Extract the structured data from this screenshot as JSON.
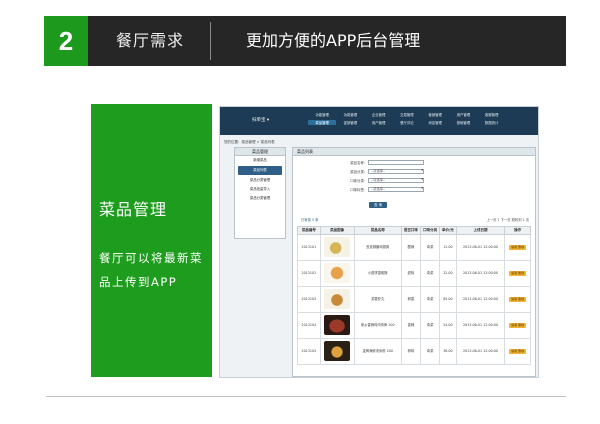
{
  "header": {
    "number": "2",
    "section": "餐厅需求",
    "title": "更加方便的APP后台管理"
  },
  "card": {
    "title": "菜品管理",
    "desc": "餐厅可以将最新菜品上传到APP"
  },
  "colors": {
    "header_bg": "#262626",
    "accent_green": "#1d9a1d",
    "app_nav_bg": "#1d3b54",
    "app_highlight": "#2f5f86",
    "edit_button": "#f2b233"
  },
  "app": {
    "brand": "扫单宝",
    "nav": [
      "功能管理",
      "功能管理",
      "企业管理",
      "交易管理",
      "营销管理",
      "用户管理",
      "客服管理",
      "菜品管理",
      "促销管理",
      "用户管理",
      "餐厅评论",
      "消息管理",
      "基础管理",
      "数据统计"
    ],
    "breadcrumb": "您的位置：菜品管理 > 菜品列表",
    "sidebar": {
      "header": "菜品管理",
      "items": [
        "新增菜品",
        "菜品列表",
        "菜品分类管理",
        "菜品批量导入",
        "菜品分类管理"
      ]
    },
    "panel_title": "菜品列表",
    "filters": [
      {
        "label": "菜品名称:",
        "value": "",
        "select": false
      },
      {
        "label": "菜品分类:",
        "value": "--请选择--",
        "select": true
      },
      {
        "label": "口味分类:",
        "value": "--请选择--",
        "select": true
      },
      {
        "label": "口味标签:",
        "value": "--请选择--",
        "select": true
      }
    ],
    "search_button": "查 询",
    "table_info": "已有菜 5 条",
    "pager": "上一页 1 下一页 跳转到 1 页",
    "columns": [
      "菜品编号",
      "菜品图像",
      "菜品名称",
      "是否口味",
      "口味分类",
      "单价/元",
      "上线日期",
      "操作"
    ],
    "rows": [
      {
        "id": "2013101",
        "name": "宫廷御膳鸡翅爽",
        "taste": "酸辣",
        "category": "粤菜",
        "price": "12.00",
        "date": "2013-06-01 12:00:00",
        "action": "编辑 删除"
      },
      {
        "id": "2013102",
        "name": "小甜饼香蕉酥",
        "taste": "甜味",
        "category": "粤菜",
        "price": "22.00",
        "date": "2013-06-01 12:00:00",
        "action": "编辑 删除"
      },
      {
        "id": "2013103",
        "name": "芙蓉虾丸",
        "taste": "鲜香",
        "category": "粤菜",
        "price": "65.00",
        "date": "2013-06-01 12:00:00",
        "action": "编辑 删除"
      },
      {
        "id": "2013104",
        "name": "家乡香辣鸡肉肉串 200",
        "taste": "香辣",
        "category": "粤菜",
        "price": "24.00",
        "date": "2013-06-01 12:00:00",
        "action": "编辑 删除"
      },
      {
        "id": "2013105",
        "name": "金牌海鲜汤米粉 200",
        "taste": "鲜味",
        "category": "粤菜",
        "price": "38.00",
        "date": "2013-06-01 12:00:00",
        "action": "编辑 删除"
      }
    ]
  }
}
